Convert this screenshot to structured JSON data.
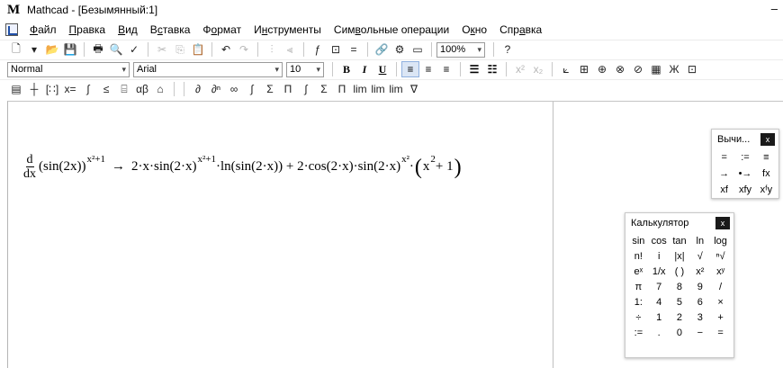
{
  "window": {
    "title": "Mathcad - [Безымянный:1]",
    "minimize": "–"
  },
  "menu": [
    {
      "pre": "",
      "accel": "Ф",
      "post": "айл"
    },
    {
      "pre": "",
      "accel": "П",
      "post": "равка"
    },
    {
      "pre": "",
      "accel": "В",
      "post": "ид"
    },
    {
      "pre": "В",
      "accel": "с",
      "post": "тавка"
    },
    {
      "pre": "Ф",
      "accel": "о",
      "post": "рмат"
    },
    {
      "pre": "И",
      "accel": "н",
      "post": "струменты"
    },
    {
      "pre": "Сим",
      "accel": "в",
      "post": "ольные операции"
    },
    {
      "pre": "О",
      "accel": "к",
      "post": "но"
    },
    {
      "pre": "Спр",
      "accel": "а",
      "post": "вка"
    }
  ],
  "toolbar_standard": {
    "zoom": "100%"
  },
  "toolbar_format": {
    "style": "Normal",
    "font": "Arial",
    "size": "10",
    "bold": "B",
    "italic": "I",
    "underline": "U"
  },
  "expression": {
    "derivative_num": "d",
    "derivative_den": "dx",
    "lhs_base": "(sin(2x))",
    "lhs_exp": "x²+1",
    "arrow": "→",
    "rhs_term1": "2·x·sin(2·x)",
    "rhs_term1_exp": "x²+1",
    "rhs_term1_tail": "·ln(sin(2·x)) + 2·cos(2·x)·sin(2·x)",
    "rhs_term2_exp": "x²",
    "rhs_dot": "·",
    "rhs_paren_open": "(",
    "rhs_inner": "x",
    "rhs_inner_exp": "2",
    "rhs_inner_tail": " + 1",
    "rhs_paren_close": ")"
  },
  "eval_panel": {
    "title": "Вычи...",
    "close": "x",
    "buttons": [
      "=",
      ":=",
      "≡",
      "→",
      "•→",
      "fx",
      "xf",
      "xfy",
      "xᶠy"
    ]
  },
  "calc_panel": {
    "title": "Калькулятор",
    "close": "x",
    "buttons": [
      "sin",
      "cos",
      "tan",
      "ln",
      "log",
      "n!",
      "i",
      "|x|",
      "√",
      "ⁿ√",
      "eˣ",
      "1/x",
      "( )",
      "x²",
      "xʸ",
      "π",
      "7",
      "8",
      "9",
      "/",
      "1:",
      "4",
      "5",
      "6",
      "×",
      "÷",
      "1",
      "2",
      "3",
      "+",
      ":=",
      ".",
      "0",
      "−",
      "="
    ]
  }
}
